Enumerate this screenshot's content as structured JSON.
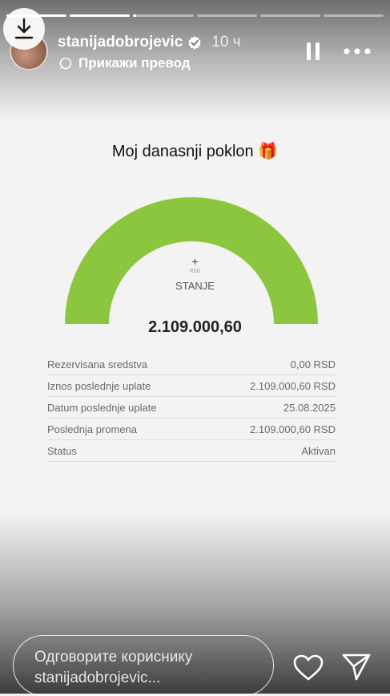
{
  "story": {
    "progress_segments": [
      1,
      1,
      0.05,
      0,
      0,
      0
    ]
  },
  "header": {
    "username": "stanijadobrojevic",
    "time": "10 ч",
    "translate_label": "Прикажи превод"
  },
  "content": {
    "title": "Moj danasnji poklon 🎁",
    "gauge_plus": "+",
    "gauge_currency": "RSD",
    "gauge_label": "STANJE",
    "gauge_color": "#8cc63f",
    "balance": "2.109.000,60",
    "details": [
      {
        "label": "Rezervisana sredstva",
        "value": "0,00 RSD"
      },
      {
        "label": "Iznos poslednje uplate",
        "value": "2.109.000,60 RSD"
      },
      {
        "label": "Datum poslednje uplate",
        "value": "25.08.2025"
      },
      {
        "label": "Poslednja promena",
        "value": "2.109.000,60 RSD"
      },
      {
        "label": "Status",
        "value": "Aktivan"
      }
    ]
  },
  "footer": {
    "reply_placeholder": "Одговорите кориснику stanijadobrojevic...",
    "reply_line1": "Одговорите кориснику",
    "reply_line2": "stanijadobrojevic..."
  }
}
